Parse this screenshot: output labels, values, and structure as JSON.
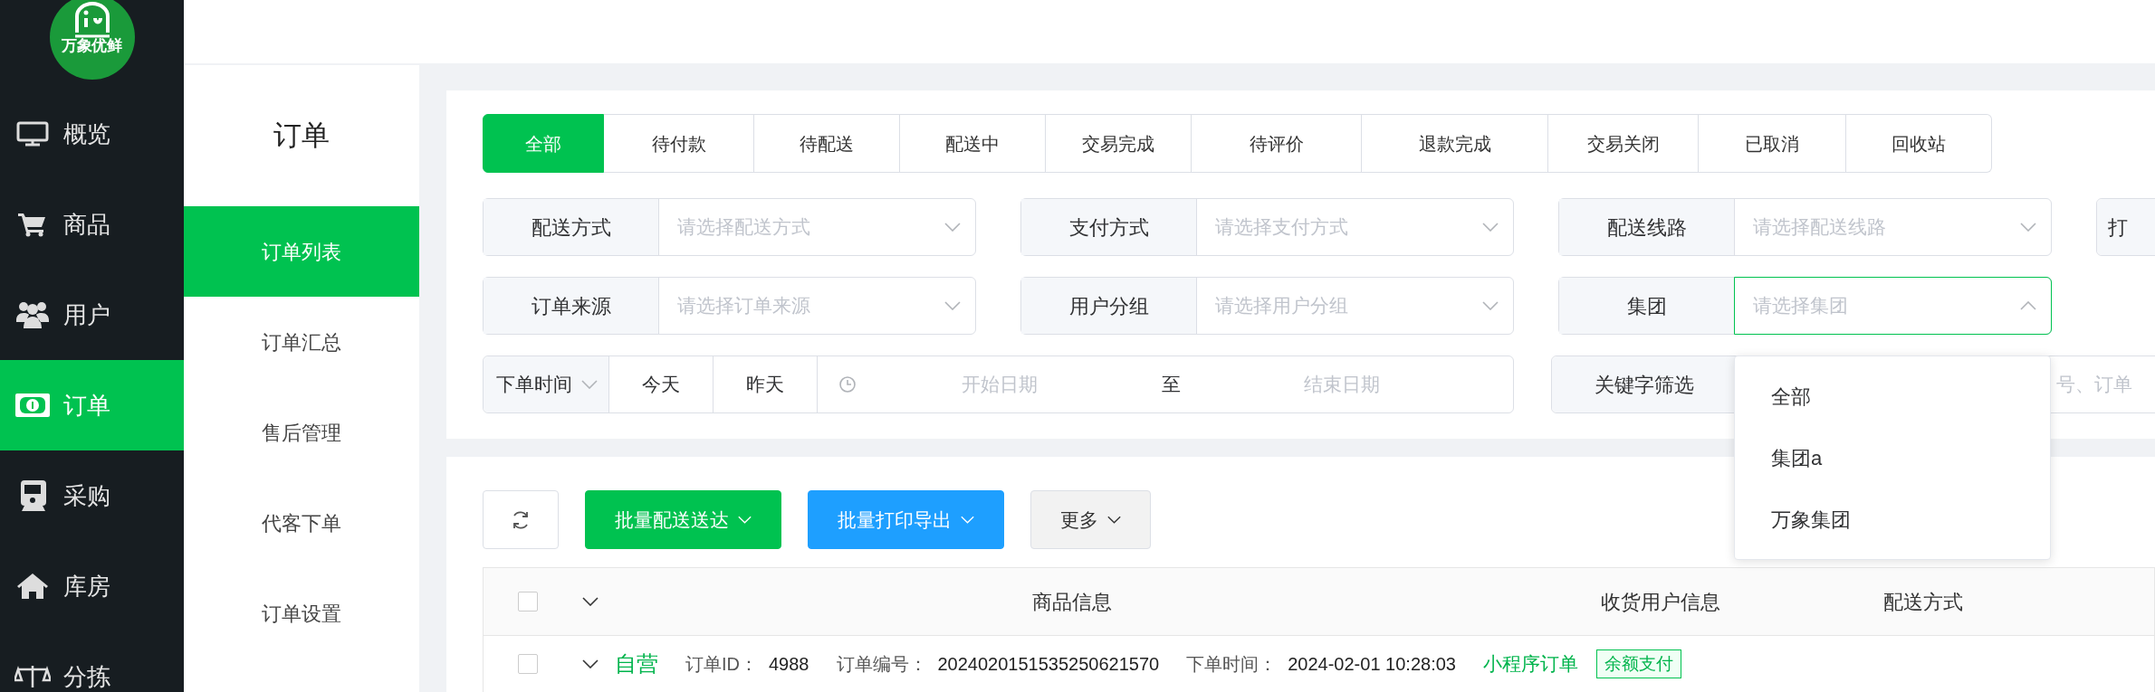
{
  "logo": {
    "text": "万象优鲜"
  },
  "nav": [
    {
      "label": "概览",
      "selected": false
    },
    {
      "label": "商品",
      "selected": false
    },
    {
      "label": "用户",
      "selected": false
    },
    {
      "label": "订单",
      "selected": true
    },
    {
      "label": "采购",
      "selected": false
    },
    {
      "label": "库房",
      "selected": false
    },
    {
      "label": "分拣",
      "selected": false
    }
  ],
  "subnav": {
    "title": "订单",
    "items": [
      {
        "label": "订单列表",
        "selected": true
      },
      {
        "label": "订单汇总",
        "selected": false
      },
      {
        "label": "售后管理",
        "selected": false
      },
      {
        "label": "代客下单",
        "selected": false
      },
      {
        "label": "订单设置",
        "selected": false
      }
    ]
  },
  "status_tabs": [
    {
      "label": "全部",
      "selected": true
    },
    {
      "label": "待付款",
      "selected": false
    },
    {
      "label": "待配送",
      "selected": false
    },
    {
      "label": "配送中",
      "selected": false
    },
    {
      "label": "交易完成",
      "selected": false
    },
    {
      "label": "待评价",
      "selected": false
    },
    {
      "label": "退款完成",
      "selected": false
    },
    {
      "label": "交易关闭",
      "selected": false
    },
    {
      "label": "已取消",
      "selected": false
    },
    {
      "label": "回收站",
      "selected": false
    }
  ],
  "filters": [
    {
      "kind": "select",
      "label": "配送方式",
      "placeholder": "请选择配送方式",
      "open": false
    },
    {
      "kind": "select",
      "label": "支付方式",
      "placeholder": "请选择支付方式",
      "open": false
    },
    {
      "kind": "select",
      "label": "配送线路",
      "placeholder": "请选择配送线路",
      "open": false
    },
    {
      "kind": "cut",
      "label": "打"
    },
    {
      "kind": "select",
      "label": "订单来源",
      "placeholder": "请选择订单来源",
      "open": false
    },
    {
      "kind": "select",
      "label": "用户分组",
      "placeholder": "请选择用户分组",
      "open": false
    },
    {
      "kind": "select",
      "label": "集团",
      "placeholder": "请选择集团",
      "open": true,
      "options": [
        "全部",
        "集团a",
        "万象集团"
      ]
    },
    {
      "kind": "date_range",
      "label": "下单时间",
      "quick": [
        "今天",
        "昨天"
      ],
      "start_placeholder": "开始日期",
      "separator": "至",
      "end_placeholder": "结束日期"
    },
    {
      "kind": "keyword",
      "label": "关键字筛选",
      "placeholder": "号、订单"
    }
  ],
  "toolbar": [
    {
      "kind": "refresh"
    },
    {
      "kind": "primary",
      "label": "批量配送送达"
    },
    {
      "kind": "info",
      "label": "批量打印导出"
    },
    {
      "kind": "plain",
      "label": "更多"
    }
  ],
  "table": {
    "select_all_checked": false,
    "columns": [
      "商品信息",
      "收货用户信息",
      "配送方式"
    ],
    "rows": [
      {
        "checked": false,
        "source": "自营",
        "fields": [
          {
            "label": "订单ID：",
            "value": "4988"
          },
          {
            "label": "订单编号：",
            "value": "2024020151535250621570"
          },
          {
            "label": "下单时间：",
            "value": "2024-02-01 10:28:03"
          }
        ],
        "channel": "小程序订单",
        "payment": "余额支付"
      }
    ]
  }
}
